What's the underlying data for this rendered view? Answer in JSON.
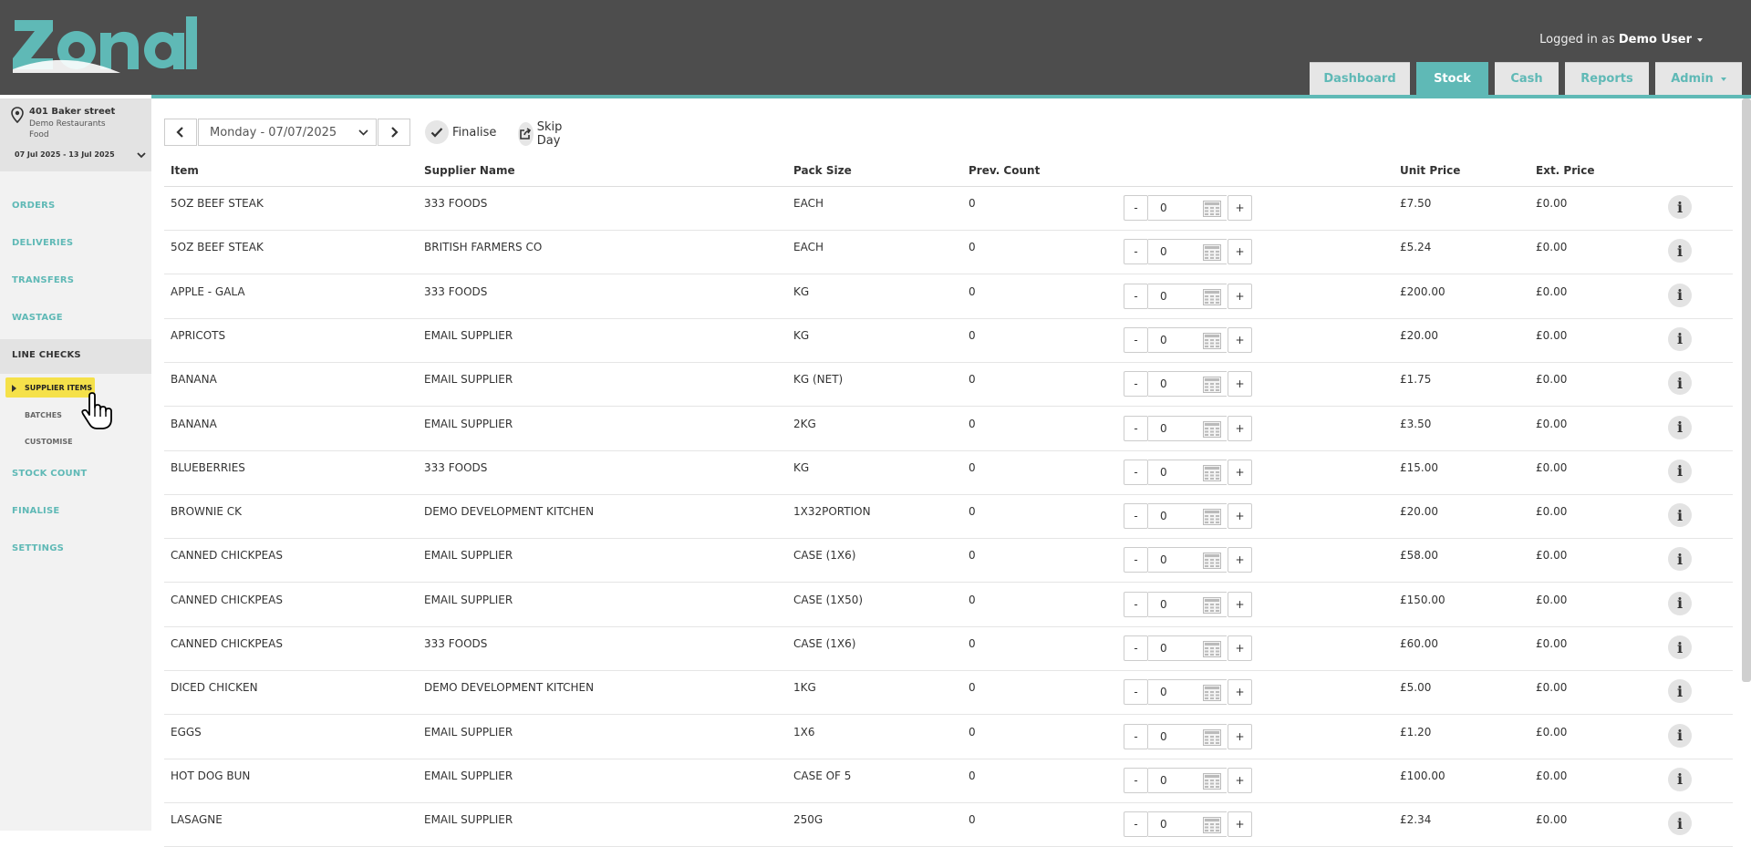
{
  "brand": {
    "logo": "Zonal"
  },
  "user": {
    "prefix": "Logged in as",
    "name": "Demo User"
  },
  "tabs": [
    {
      "label": "Dashboard",
      "active": false
    },
    {
      "label": "Stock",
      "active": true
    },
    {
      "label": "Cash",
      "active": false
    },
    {
      "label": "Reports",
      "active": false
    },
    {
      "label": "Admin",
      "active": false
    }
  ],
  "location": {
    "name": "401 Baker street",
    "line1": "Demo Restaurants",
    "line2": "Food",
    "range": "07 Jul 2025 - 13 Jul 2025"
  },
  "sidebar": {
    "items": [
      "ORDERS",
      "DELIVERIES",
      "TRANSFERS",
      "WASTAGE",
      "LINE CHECKS"
    ],
    "sub_items": [
      "SUPPLIER ITEMS",
      "BATCHES",
      "CUSTOMISE"
    ],
    "items_after": [
      "STOCK COUNT",
      "FINALISE",
      "SETTINGS"
    ]
  },
  "toolbar": {
    "date": "Monday - 07/07/2025",
    "finalise": "Finalise",
    "skip_day": "Skip Day"
  },
  "table": {
    "headers": {
      "item": "Item",
      "supplier": "Supplier Name",
      "pack": "Pack Size",
      "prev": "Prev. Count",
      "unit": "Unit Price",
      "ext": "Ext. Price"
    },
    "minus": "-",
    "plus": "+",
    "info": "i",
    "rows": [
      {
        "item": "5OZ BEEF STEAK",
        "supplier": "333 FOODS",
        "pack": "EACH",
        "prev": "0",
        "qty": "0",
        "unit": "£7.50",
        "ext": "£0.00"
      },
      {
        "item": "5OZ BEEF STEAK",
        "supplier": "BRITISH FARMERS CO",
        "pack": "EACH",
        "prev": "0",
        "qty": "0",
        "unit": "£5.24",
        "ext": "£0.00"
      },
      {
        "item": "APPLE - GALA",
        "supplier": "333 FOODS",
        "pack": "KG",
        "prev": "0",
        "qty": "0",
        "unit": "£200.00",
        "ext": "£0.00"
      },
      {
        "item": "APRICOTS",
        "supplier": "EMAIL SUPPLIER",
        "pack": "KG",
        "prev": "0",
        "qty": "0",
        "unit": "£20.00",
        "ext": "£0.00"
      },
      {
        "item": "BANANA",
        "supplier": "EMAIL SUPPLIER",
        "pack": "KG (NET)",
        "prev": "0",
        "qty": "0",
        "unit": "£1.75",
        "ext": "£0.00"
      },
      {
        "item": "BANANA",
        "supplier": "EMAIL SUPPLIER",
        "pack": "2KG",
        "prev": "0",
        "qty": "0",
        "unit": "£3.50",
        "ext": "£0.00"
      },
      {
        "item": "BLUEBERRIES",
        "supplier": "333 FOODS",
        "pack": "KG",
        "prev": "0",
        "qty": "0",
        "unit": "£15.00",
        "ext": "£0.00"
      },
      {
        "item": "BROWNIE CK",
        "supplier": "DEMO DEVELOPMENT KITCHEN",
        "pack": "1X32PORTION",
        "prev": "0",
        "qty": "0",
        "unit": "£20.00",
        "ext": "£0.00"
      },
      {
        "item": "CANNED CHICKPEAS",
        "supplier": "EMAIL SUPPLIER",
        "pack": "CASE (1X6)",
        "prev": "0",
        "qty": "0",
        "unit": "£58.00",
        "ext": "£0.00"
      },
      {
        "item": "CANNED CHICKPEAS",
        "supplier": "EMAIL SUPPLIER",
        "pack": "CASE (1X50)",
        "prev": "0",
        "qty": "0",
        "unit": "£150.00",
        "ext": "£0.00"
      },
      {
        "item": "CANNED CHICKPEAS",
        "supplier": "333 FOODS",
        "pack": "CASE (1X6)",
        "prev": "0",
        "qty": "0",
        "unit": "£60.00",
        "ext": "£0.00"
      },
      {
        "item": "DICED CHICKEN",
        "supplier": "DEMO DEVELOPMENT KITCHEN",
        "pack": "1KG",
        "prev": "0",
        "qty": "0",
        "unit": "£5.00",
        "ext": "£0.00"
      },
      {
        "item": "EGGS",
        "supplier": "EMAIL SUPPLIER",
        "pack": "1X6",
        "prev": "0",
        "qty": "0",
        "unit": "£1.20",
        "ext": "£0.00"
      },
      {
        "item": "HOT DOG BUN",
        "supplier": "EMAIL SUPPLIER",
        "pack": "CASE OF 5",
        "prev": "0",
        "qty": "0",
        "unit": "£100.00",
        "ext": "£0.00"
      },
      {
        "item": "LASAGNE",
        "supplier": "EMAIL SUPPLIER",
        "pack": "250G",
        "prev": "0",
        "qty": "0",
        "unit": "£2.34",
        "ext": "£0.00"
      }
    ]
  },
  "colors": {
    "accent": "#5fb9b6",
    "header": "#4d4d4d",
    "highlight": "#f5e14a"
  }
}
